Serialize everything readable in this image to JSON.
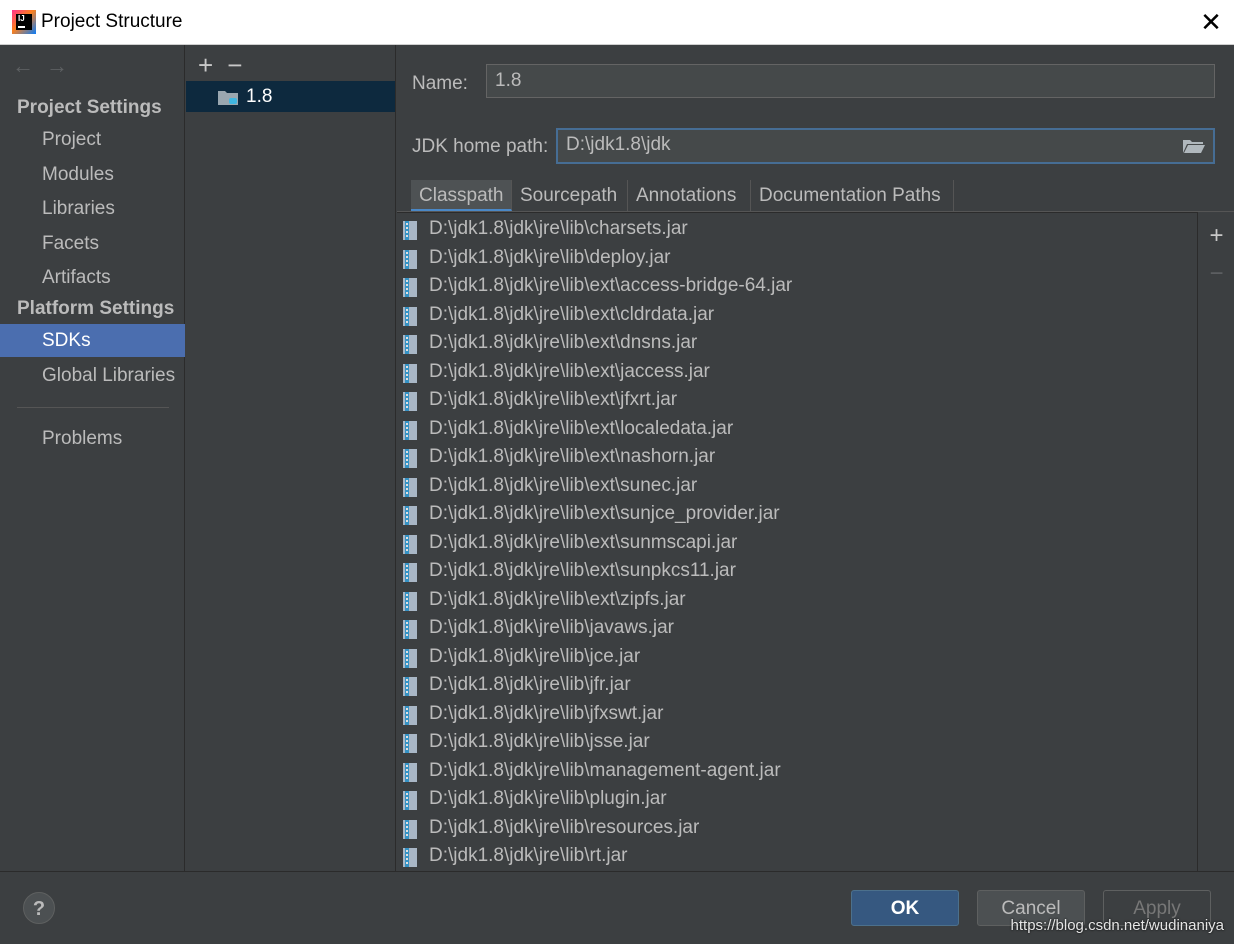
{
  "window": {
    "title": "Project Structure",
    "close_label": "✕"
  },
  "nav": {
    "back_label": "←",
    "forward_label": "→",
    "project_settings_header": "Project Settings",
    "project_items": [
      "Project",
      "Modules",
      "Libraries",
      "Facets",
      "Artifacts"
    ],
    "platform_settings_header": "Platform Settings",
    "platform_items": [
      "SDKs",
      "Global Libraries"
    ],
    "problems_label": "Problems",
    "selected": "SDKs"
  },
  "sdk_list": {
    "add_label": "+",
    "remove_label": "−",
    "items": [
      {
        "label": "1.8",
        "icon": "jdk-folder-icon"
      }
    ]
  },
  "sdk_details": {
    "name_label": "Name:",
    "name_value": "1.8",
    "jdk_home_label": "JDK home path:",
    "jdk_home_value": "D:\\jdk1.8\\jdk"
  },
  "tabs": {
    "items": [
      "Classpath",
      "Sourcepath",
      "Annotations",
      "Documentation Paths"
    ],
    "active": "Classpath"
  },
  "classpath": [
    "D:\\jdk1.8\\jdk\\jre\\lib\\charsets.jar",
    "D:\\jdk1.8\\jdk\\jre\\lib\\deploy.jar",
    "D:\\jdk1.8\\jdk\\jre\\lib\\ext\\access-bridge-64.jar",
    "D:\\jdk1.8\\jdk\\jre\\lib\\ext\\cldrdata.jar",
    "D:\\jdk1.8\\jdk\\jre\\lib\\ext\\dnsns.jar",
    "D:\\jdk1.8\\jdk\\jre\\lib\\ext\\jaccess.jar",
    "D:\\jdk1.8\\jdk\\jre\\lib\\ext\\jfxrt.jar",
    "D:\\jdk1.8\\jdk\\jre\\lib\\ext\\localedata.jar",
    "D:\\jdk1.8\\jdk\\jre\\lib\\ext\\nashorn.jar",
    "D:\\jdk1.8\\jdk\\jre\\lib\\ext\\sunec.jar",
    "D:\\jdk1.8\\jdk\\jre\\lib\\ext\\sunjce_provider.jar",
    "D:\\jdk1.8\\jdk\\jre\\lib\\ext\\sunmscapi.jar",
    "D:\\jdk1.8\\jdk\\jre\\lib\\ext\\sunpkcs11.jar",
    "D:\\jdk1.8\\jdk\\jre\\lib\\ext\\zipfs.jar",
    "D:\\jdk1.8\\jdk\\jre\\lib\\javaws.jar",
    "D:\\jdk1.8\\jdk\\jre\\lib\\jce.jar",
    "D:\\jdk1.8\\jdk\\jre\\lib\\jfr.jar",
    "D:\\jdk1.8\\jdk\\jre\\lib\\jfxswt.jar",
    "D:\\jdk1.8\\jdk\\jre\\lib\\jsse.jar",
    "D:\\jdk1.8\\jdk\\jre\\lib\\management-agent.jar",
    "D:\\jdk1.8\\jdk\\jre\\lib\\plugin.jar",
    "D:\\jdk1.8\\jdk\\jre\\lib\\resources.jar",
    "D:\\jdk1.8\\jdk\\jre\\lib\\rt.jar"
  ],
  "side_tools": {
    "add_label": "+",
    "remove_label": "−"
  },
  "footer": {
    "help_label": "?",
    "ok_label": "OK",
    "cancel_label": "Cancel",
    "apply_label": "Apply",
    "watermark": "https://blog.csdn.net/wudinaniya"
  },
  "colors": {
    "background": "#3c3f41",
    "selection": "#4b6eaf",
    "sdk_selection": "#0d293e",
    "ok_button": "#365880",
    "text": "#bbbbbb"
  }
}
